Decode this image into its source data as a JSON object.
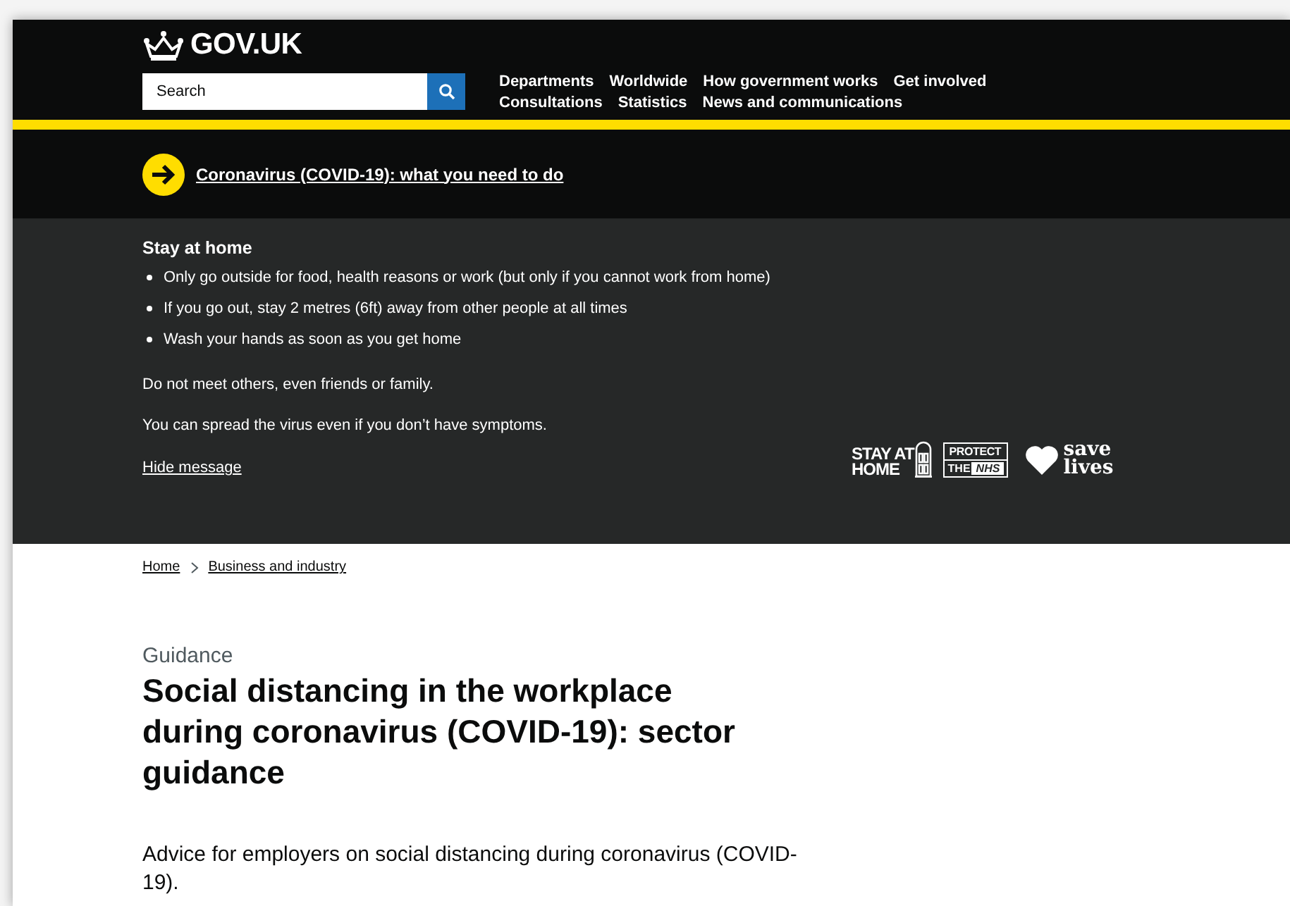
{
  "header": {
    "logo": "GOV.UK",
    "search": {
      "placeholder": "Search"
    },
    "nav_rows": [
      [
        "Departments",
        "Worldwide",
        "How government works",
        "Get involved"
      ],
      [
        "Consultations",
        "Statistics",
        "News and communications"
      ]
    ]
  },
  "covid_link": "Coronavirus (COVID-19): what you need to do",
  "banner": {
    "heading": "Stay at home",
    "bullets": [
      "Only go outside for food, health reasons or work (but only if you cannot work from home)",
      "If you go out, stay 2 metres (6ft) away from other people at all times",
      "Wash your hands as soon as you get home"
    ],
    "paragraphs": [
      "Do not meet others, even friends or family.",
      "You can spread the virus even if you don’t have symptoms."
    ],
    "hide_link": "Hide message",
    "campaign": {
      "stay": [
        "STAY AT",
        "HOME"
      ],
      "protect": [
        "PROTECT",
        "THE",
        "NHS"
      ],
      "save": [
        "save",
        "lives"
      ]
    }
  },
  "breadcrumbs": [
    "Home",
    "Business and industry"
  ],
  "document": {
    "type": "Guidance",
    "title": "Social distancing in the workplace during coronavirus (COVID-19): sector guidance",
    "summary": "Advice for employers on social distancing during coronavirus (COVID-19)."
  }
}
